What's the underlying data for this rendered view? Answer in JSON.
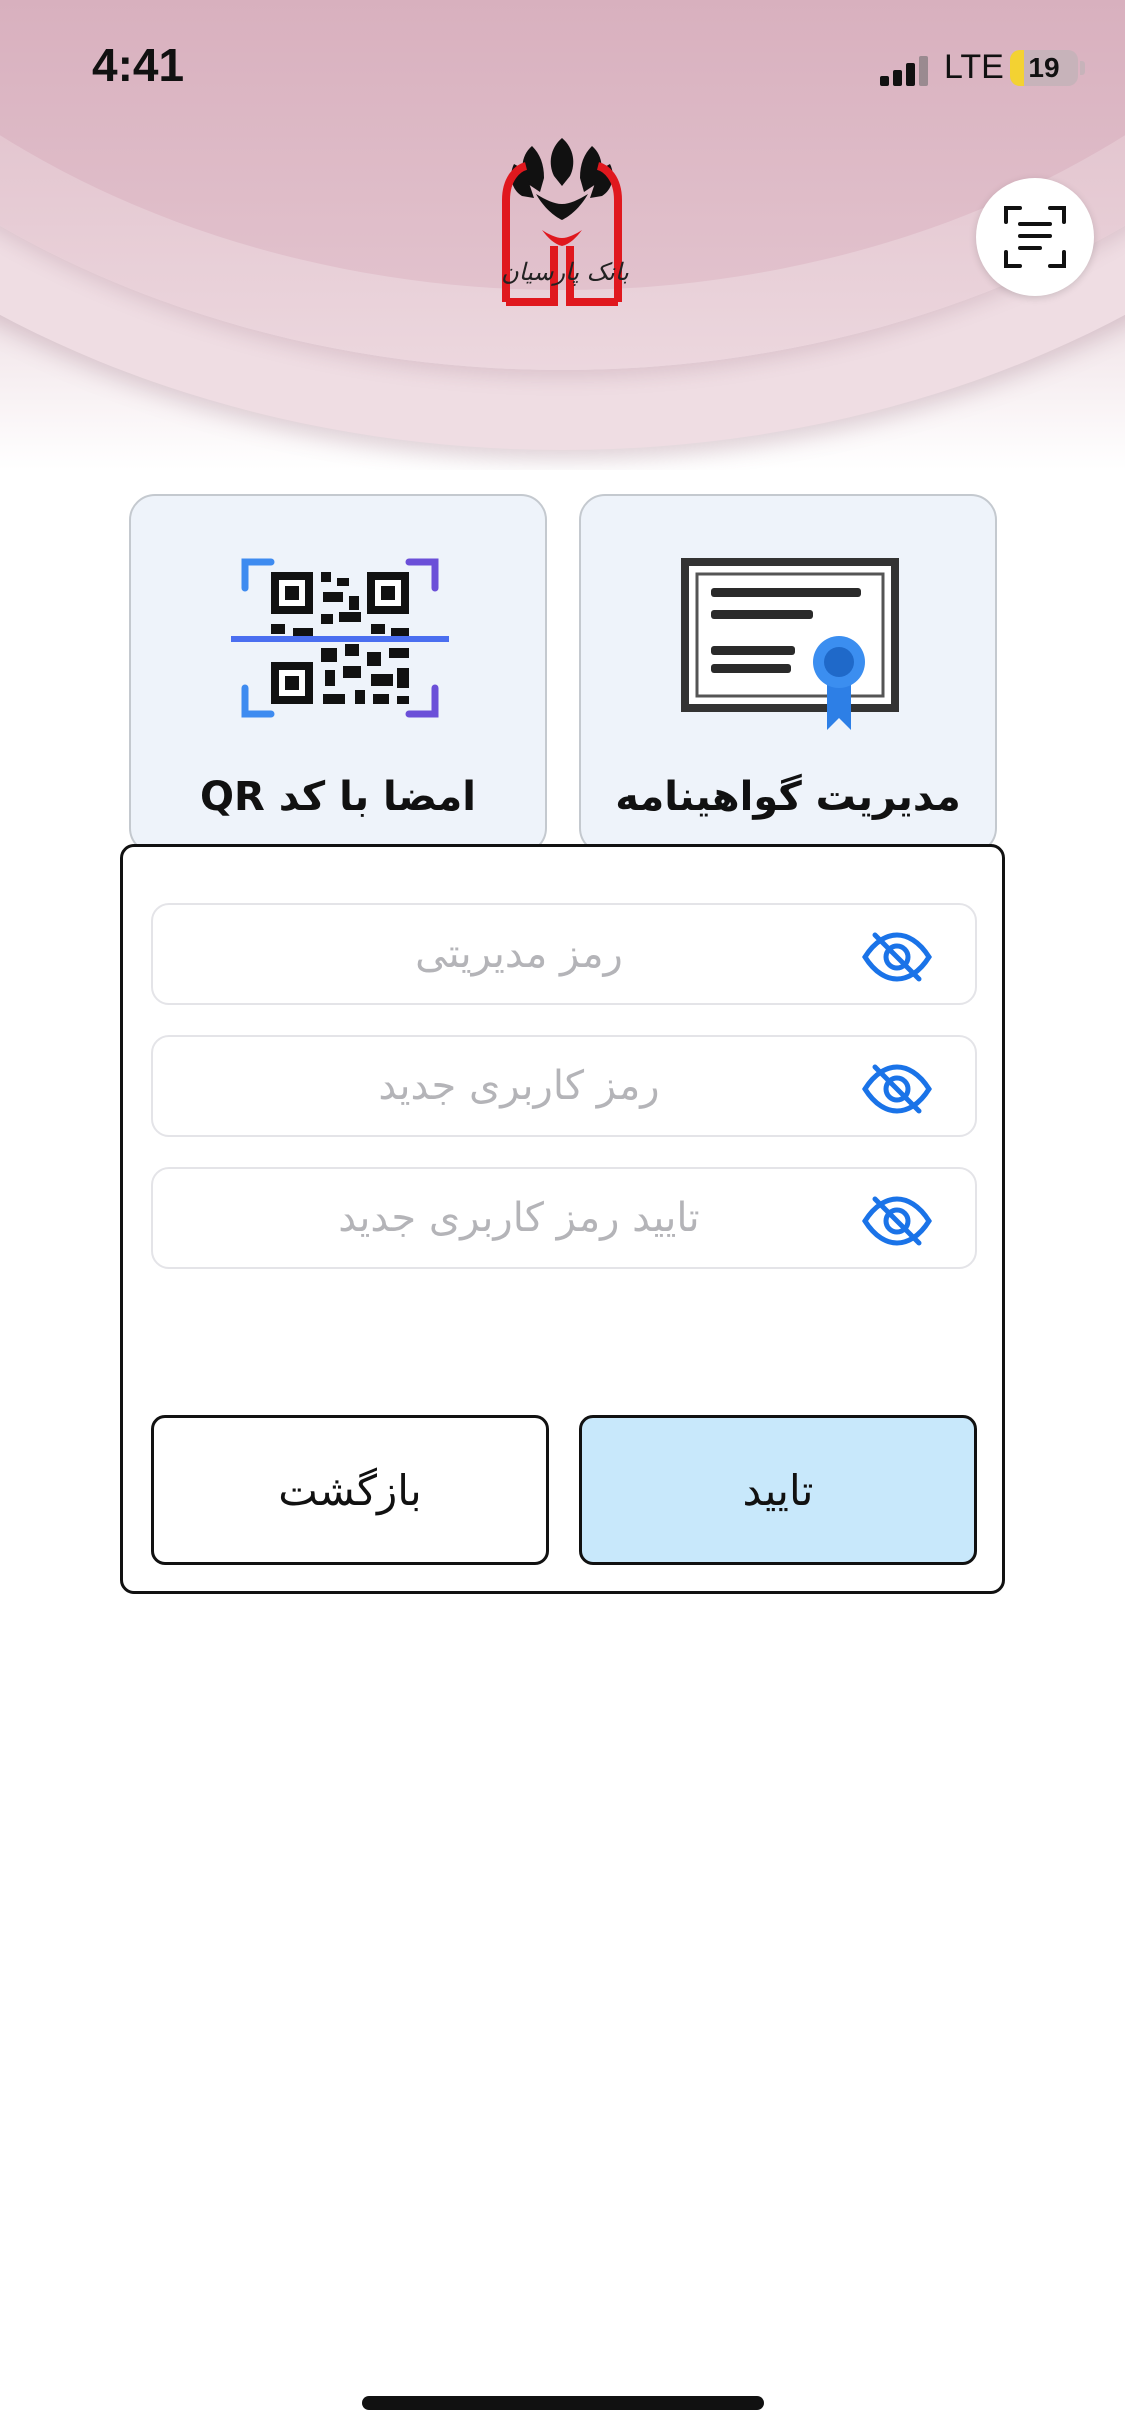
{
  "status_bar": {
    "time": "4:41",
    "network": "LTE",
    "battery": "19"
  },
  "header": {
    "logo_text": "بانک پارسیان",
    "scan_icon": "document-scan-icon"
  },
  "tiles": [
    {
      "label": "مدیریت گواهینامه",
      "icon": "certificate-icon"
    },
    {
      "label": "امضا با کد QR",
      "icon": "qr-scan-icon"
    }
  ],
  "dialog": {
    "fields": [
      {
        "placeholder": "رمز مدیریتی",
        "value": "",
        "icon": "eye-off-icon"
      },
      {
        "placeholder": "رمز کاربری جدید",
        "value": "",
        "icon": "eye-off-icon"
      },
      {
        "placeholder": "تایید رمز کاربری جدید",
        "value": "",
        "icon": "eye-off-icon"
      }
    ],
    "confirm_label": "تایید",
    "back_label": "بازگشت"
  },
  "colors": {
    "accent": "#1a73e8",
    "confirm_bg": "#c8e8fb",
    "logo_red": "#e0181e",
    "header_pink": "#d3a7b6"
  }
}
